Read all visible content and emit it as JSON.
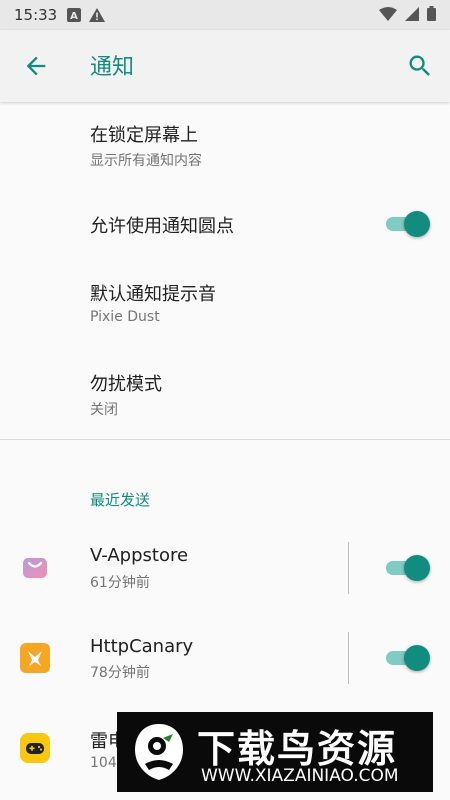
{
  "status_bar": {
    "time": "15:33",
    "left_icons": [
      "a-notification-icon",
      "warning-icon"
    ],
    "right_icons": [
      "wifi-icon",
      "signal-icon",
      "battery-icon"
    ]
  },
  "app_bar": {
    "title": "通知",
    "back_icon": "back-arrow-icon",
    "search_icon": "search-icon"
  },
  "settings": [
    {
      "title": "在锁定屏幕上",
      "subtitle": "显示所有通知内容"
    },
    {
      "title": "允许使用通知圆点",
      "toggle_on": true
    },
    {
      "title": "默认通知提示音",
      "subtitle": "Pixie Dust"
    },
    {
      "title": "勿扰模式",
      "subtitle": "关闭"
    }
  ],
  "recent_section": {
    "header": "最近发送",
    "apps": [
      {
        "name": "V-Appstore",
        "time": "61分钟前",
        "toggle_on": true,
        "icon": "v-appstore-icon"
      },
      {
        "name": "HttpCanary",
        "time": "78分钟前",
        "toggle_on": true,
        "icon": "httpcanary-icon"
      },
      {
        "name": "雷电",
        "time": "104",
        "icon": "gamepad-icon"
      }
    ]
  },
  "watermark": {
    "title": "下载鸟资源",
    "url": "WWW.XIAZAINIAO.COM"
  },
  "colors": {
    "accent": "#128c7e",
    "toggle_track": "#80cbc4",
    "background": "#fafafa"
  }
}
